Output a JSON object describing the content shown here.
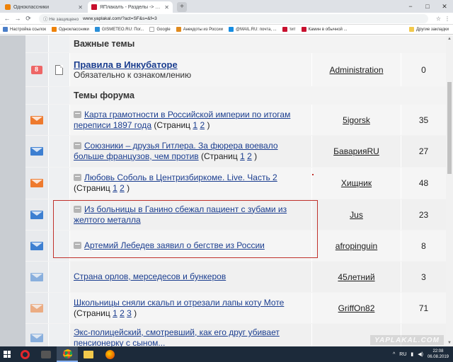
{
  "browser": {
    "tabs": [
      {
        "title": "Одноклассники",
        "active": false
      },
      {
        "title": "ЯПлакалъ - Разделы -> Инкуб",
        "active": true
      }
    ],
    "new_tab": "+",
    "window_controls": [
      "−",
      "□",
      "✕"
    ],
    "security": "ⓘ Не защищено",
    "url": "www.yaplakal.com/?act=SF&s=&f=3",
    "bookmarks": [
      "Настройка ссылок",
      "Одноклассники",
      "GISMETEO.RU: Пог...",
      "Google",
      "Анекдоты из России",
      "@MAIL.RU: почта, ...",
      "тит",
      "Камин в обычной ..."
    ],
    "other_bookmarks": "Другие закладки"
  },
  "forum": {
    "section_important": "Важные темы",
    "pinned": {
      "title": "Правила в Инкубаторе",
      "subtitle": "Обязательно к ознакомлению",
      "author": "Administration",
      "replies": "0"
    },
    "section_topics": "Темы форума",
    "topics": [
      {
        "title": "Карта грамотности в Российской империи по итогам переписи 1897 года",
        "pages_label": "(Страниц",
        "pages": [
          "1",
          "2"
        ],
        "author": "5igorsk",
        "replies": "35",
        "icon": "orange",
        "mini": true
      },
      {
        "title": "Союзники – друзья Гитлера. За фюрера воевало больше французов, чем против",
        "pages_label": "(Страниц",
        "pages": [
          "1",
          "2"
        ],
        "author": "БаварияRU",
        "replies": "27",
        "icon": "blue",
        "mini": true
      },
      {
        "title": "Любовь Соболь в Центризбиркоме. Live. Часть 2",
        "pages_label": "(Страниц",
        "pages": [
          "1",
          "2"
        ],
        "author": "Хищник",
        "replies": "48",
        "icon": "orange",
        "mini": true
      },
      {
        "title": "Из больницы в Ганино сбежал пациент с зубами из желтого металла",
        "pages_label": "",
        "pages": [],
        "author": "Jus",
        "replies": "23",
        "icon": "blue",
        "mini": true
      },
      {
        "title": "Артемий Лебедев заявил о бегстве из России",
        "pages_label": "",
        "pages": [],
        "author": "afropinguin",
        "replies": "8",
        "icon": "blue",
        "mini": true
      },
      {
        "title": "Страна орлов, мерседесов и бункеров",
        "pages_label": "",
        "pages": [],
        "author": "45летний",
        "replies": "3",
        "icon": "blue-faded",
        "mini": false
      },
      {
        "title": "Школьницы сняли скальп и отрезали лапы коту Моте",
        "pages_label": "(Страниц",
        "pages": [
          "1",
          "2",
          "3"
        ],
        "author": "GriffOn82",
        "replies": "71",
        "icon": "orange-faded",
        "mini": false
      },
      {
        "title": "Экс-полицейский, смотревший, как его друг убивает пенсионерку с сыном...",
        "pages_label": "",
        "pages": [],
        "author": "",
        "replies": "",
        "icon": "blue-faded",
        "mini": false
      }
    ]
  },
  "watermark": "YAPLAKAL.COM",
  "taskbar": {
    "lang": "RU",
    "time": "22:08",
    "date": "06.08.2019"
  },
  "colors": {
    "link": "#1a3d8f",
    "highlight": "#c0312b",
    "orange_icon": "#ee7a2e",
    "blue_icon": "#3d7fd1"
  }
}
